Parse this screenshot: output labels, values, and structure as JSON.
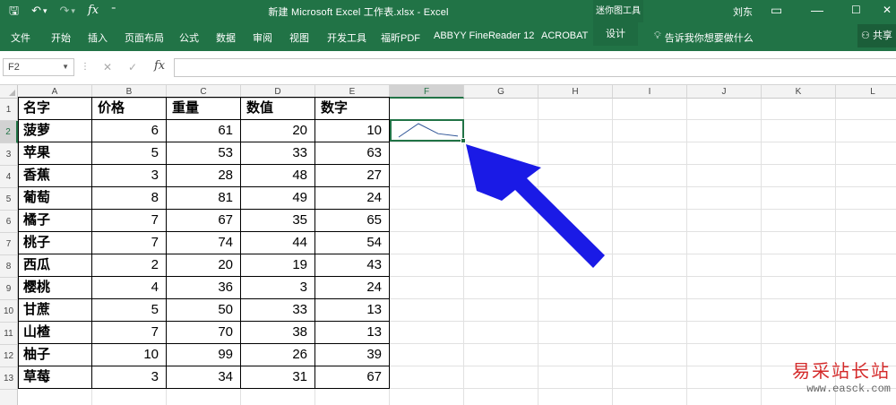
{
  "titlebar": {
    "title": "新建 Microsoft Excel 工作表.xlsx  -  Excel",
    "contextual_tools": "迷你图工具",
    "user": "刘东",
    "qat": {
      "save": "🖫",
      "undo": "↶",
      "undo_dd": "▾",
      "redo": "↷",
      "redo_dd": "▾",
      "fx": "fx",
      "more": "⁼"
    },
    "controls": {
      "restore": "▭",
      "minimize": "—",
      "maximize": "☐",
      "close": "✕"
    }
  },
  "ribbon": {
    "tabs": [
      "文件",
      "开始",
      "插入",
      "页面布局",
      "公式",
      "数据",
      "审阅",
      "视图",
      "开发工具",
      "福昕PDF",
      "ABBYY FineReader 12",
      "ACROBAT",
      "设计"
    ],
    "tell_me": "告诉我你想要做什么",
    "share": "共享"
  },
  "formula_bar": {
    "name_box": "F2",
    "cancel": "✕",
    "enter": "✓",
    "fx": "fx",
    "formula": ""
  },
  "sheet": {
    "columns": [
      "A",
      "B",
      "C",
      "D",
      "E",
      "F",
      "G",
      "H",
      "I",
      "J",
      "K",
      "L"
    ],
    "selected_column": "F",
    "selected_row": 2,
    "rows": [
      1,
      2,
      3,
      4,
      5,
      6,
      7,
      8,
      9,
      10,
      11,
      12,
      13
    ],
    "headers": [
      "名字",
      "价格",
      "重量",
      "数值",
      "数字"
    ],
    "data": [
      [
        "菠萝",
        6,
        61,
        20,
        10
      ],
      [
        "苹果",
        5,
        53,
        33,
        63
      ],
      [
        "香蕉",
        3,
        28,
        48,
        27
      ],
      [
        "葡萄",
        8,
        81,
        49,
        24
      ],
      [
        "橘子",
        7,
        67,
        35,
        65
      ],
      [
        "桃子",
        7,
        74,
        44,
        54
      ],
      [
        "西瓜",
        2,
        20,
        19,
        43
      ],
      [
        "樱桃",
        4,
        36,
        3,
        24
      ],
      [
        "甘蔗",
        5,
        50,
        33,
        13
      ],
      [
        "山楂",
        7,
        70,
        38,
        13
      ],
      [
        "柚子",
        10,
        99,
        26,
        39
      ],
      [
        "草莓",
        3,
        34,
        31,
        67
      ]
    ],
    "sparkline": {
      "cell": "F2",
      "values": [
        6,
        61,
        20,
        10
      ],
      "color": "#2f5597"
    }
  },
  "annotation": {
    "arrow_color": "#1a1ae6",
    "points_to": "F2"
  },
  "watermark": {
    "text": "易采站长站",
    "url": "www.easck.com"
  },
  "colors": {
    "excel_green": "#217346",
    "grid": "#e1e1e1"
  }
}
